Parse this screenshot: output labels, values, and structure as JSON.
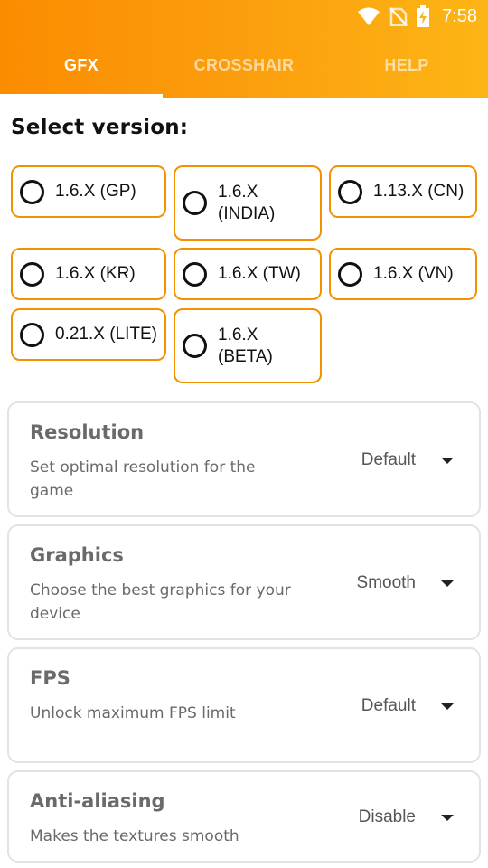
{
  "status_bar": {
    "time": "7:58",
    "icons": [
      "wifi-icon",
      "no-sim-icon",
      "battery-charging-icon"
    ]
  },
  "tabs": [
    {
      "label": "GFX",
      "active": true
    },
    {
      "label": "CROSSHAIR",
      "active": false
    },
    {
      "label": "HELP",
      "active": false
    }
  ],
  "section_title": "Select version:",
  "versions": [
    {
      "label": "1.6.X (GP)",
      "selected": false
    },
    {
      "label": "1.6.X\n(INDIA)",
      "selected": false
    },
    {
      "label": "1.13.X (CN)",
      "selected": false
    },
    {
      "label": "1.6.X (KR)",
      "selected": false
    },
    {
      "label": "1.6.X (TW)",
      "selected": false
    },
    {
      "label": "1.6.X (VN)",
      "selected": false
    },
    {
      "label": "0.21.X (LITE)",
      "selected": false
    },
    {
      "label": "1.6.X\n(BETA)",
      "selected": false
    }
  ],
  "settings": [
    {
      "title": "Resolution",
      "description": "Set optimal resolution for the game",
      "value": "Default"
    },
    {
      "title": "Graphics",
      "description": "Choose the best graphics for your device",
      "value": "Smooth"
    },
    {
      "title": "FPS",
      "description": "Unlock maximum FPS limit",
      "value": "Default"
    },
    {
      "title": "Anti-aliasing",
      "description": "Makes the textures smooth",
      "value": "Disable"
    }
  ],
  "colors": {
    "accent": "#f39200",
    "header_start": "#fb8c00",
    "header_end": "#fdb515",
    "card_border": "#e3e3e3"
  }
}
